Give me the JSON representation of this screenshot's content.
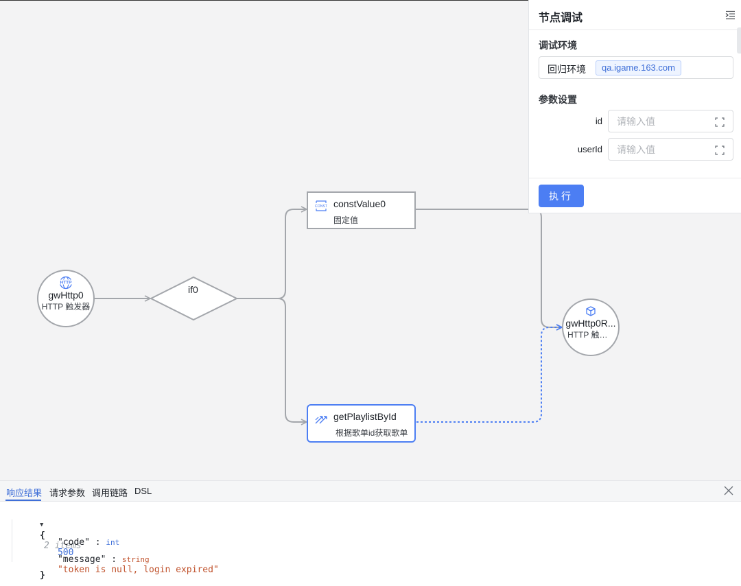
{
  "canvas": {
    "nodes": {
      "trigger": {
        "title": "gwHttp0",
        "subtitle": "HTTP 触发器",
        "icon": "http-globe-icon"
      },
      "condition": {
        "title": "if0"
      },
      "const": {
        "title": "constValue0",
        "subtitle": "固定值",
        "icon": "const-icon"
      },
      "api": {
        "title": "getPlaylistById",
        "subtitle": "根据歌单id获取歌单",
        "icon": "api-arrows-icon"
      },
      "response": {
        "title": "gwHttp0R...",
        "subtitle": "HTTP 触发...",
        "icon": "cube-icon"
      }
    },
    "colors": {
      "edge": "#a3a6ab",
      "active_edge": "#4c7ef3",
      "node_border": "#a3a6ab",
      "selected_border": "#4c7ef3"
    }
  },
  "panel": {
    "title": "节点调试",
    "env_section": "调试环境",
    "env_name": "回归环境",
    "env_host": "qa.igame.163.com",
    "params_section": "参数设置",
    "params": [
      {
        "label": "id",
        "placeholder": "请输入值"
      },
      {
        "label": "userId",
        "placeholder": "请输入值"
      }
    ],
    "run_label": "执行",
    "accent": "#4c7ef3"
  },
  "bottom": {
    "tabs": [
      "响应结果",
      "请求参数",
      "调用链路",
      "DSL"
    ],
    "active_tab": "响应结果",
    "json_view": {
      "open_brace": "{",
      "count": "2 items",
      "entries": [
        {
          "key": "\"code\"",
          "sep": " : ",
          "type": "int",
          "value": "500"
        },
        {
          "key": "\"message\"",
          "sep": " : ",
          "type": "string",
          "value": "\"token is null, login expired\""
        }
      ],
      "close_brace": "}"
    }
  }
}
